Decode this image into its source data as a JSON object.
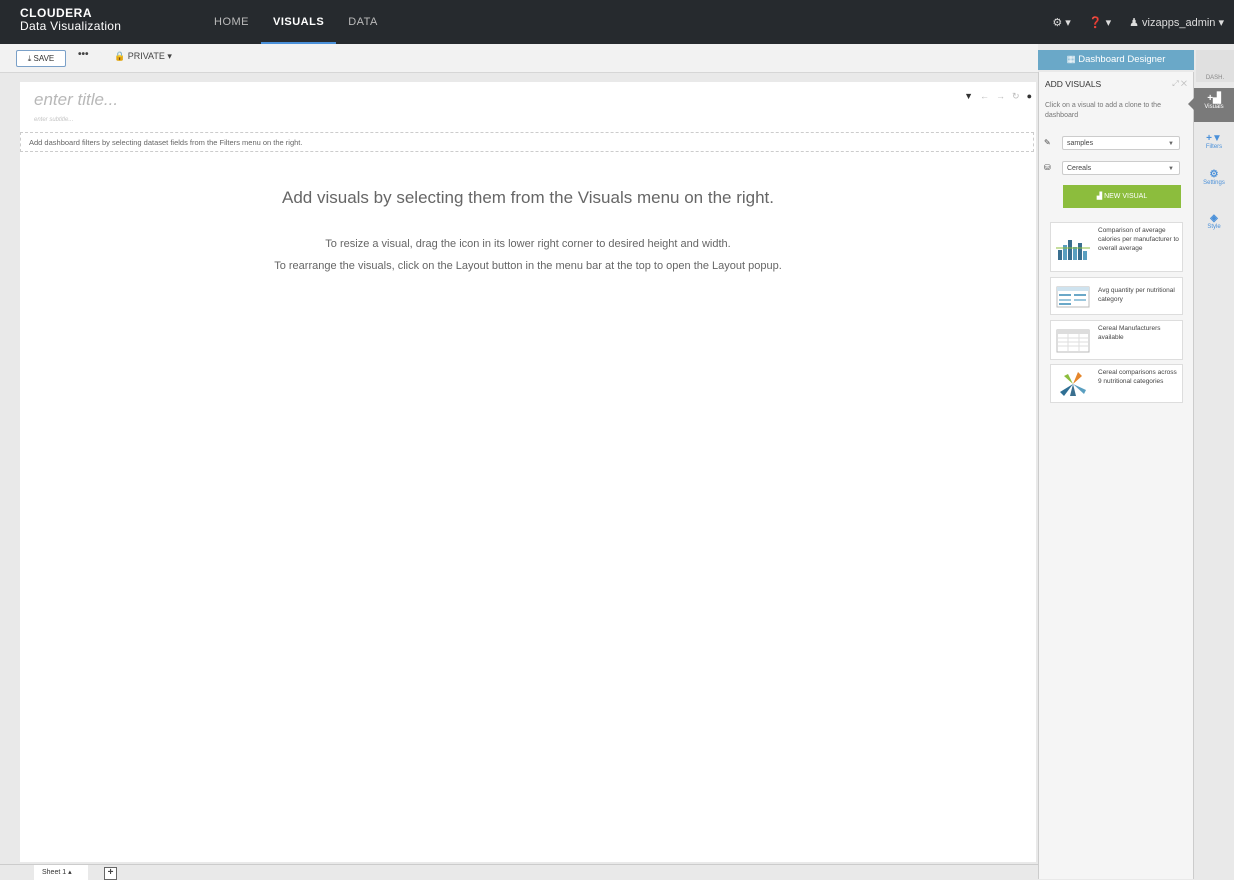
{
  "brand": {
    "company": "CLOUDERA",
    "product": "Data Visualization"
  },
  "nav": {
    "links": [
      "HOME",
      "VISUALS",
      "DATA"
    ],
    "active": "VISUALS",
    "settings_icon": "⚙ ▾",
    "help_icon": "❓ ▾",
    "user": "♟ vizapps_admin ▾"
  },
  "toolbar": {
    "save_label": "⤓ SAVE",
    "more_label": "•••",
    "privacy_label": "🔒 PRIVATE ▾"
  },
  "canvas": {
    "title_placeholder": "enter title...",
    "subtitle_placeholder": "enter subtitle...",
    "filter_hint": "Add dashboard filters by selecting dataset fields from the Filters menu on the right.",
    "main_message": "Add visuals by selecting them from the Visuals menu on the right.",
    "help_line1": "To resize a visual, drag the icon in its lower right corner to desired height and width.",
    "help_line2": "To rearrange the visuals, click on the Layout button in the menu bar at the top to open the Layout popup.",
    "icons": [
      "filter-icon",
      "undo-icon",
      "redo-icon",
      "refresh-icon"
    ]
  },
  "sheets": {
    "tabs": [
      "Sheet 1 ▴"
    ],
    "add_label": "+"
  },
  "designer": {
    "header": "▦ Dashboard Designer",
    "dash_label": "DASH.",
    "panel_title": "ADD VISUALS",
    "panel_controls": "⤢ ✕",
    "help": "Click on a visual to add a clone to the dashboard",
    "connection": "samples",
    "dataset": "Cereals",
    "new_visual": "▟ NEW VISUAL",
    "visuals": [
      "Comparison of average calories per manufacturer to overall average",
      "Avg quantity per nutritional category",
      "Cereal Manufacturers available",
      "Cereal comparisons across 9 nutritional categories"
    ]
  },
  "sidetabs": [
    {
      "icon": "+▟",
      "label": "Visuals"
    },
    {
      "icon": "+▼",
      "label": "Filters"
    },
    {
      "icon": "⚙",
      "label": "Settings"
    },
    {
      "icon": "◈",
      "label": "Style"
    }
  ],
  "colors": {
    "nav_bg": "#262a2e",
    "accent": "#4a90d9",
    "designer_header": "#6aa8c8",
    "new_visual": "#8cbd3d"
  }
}
